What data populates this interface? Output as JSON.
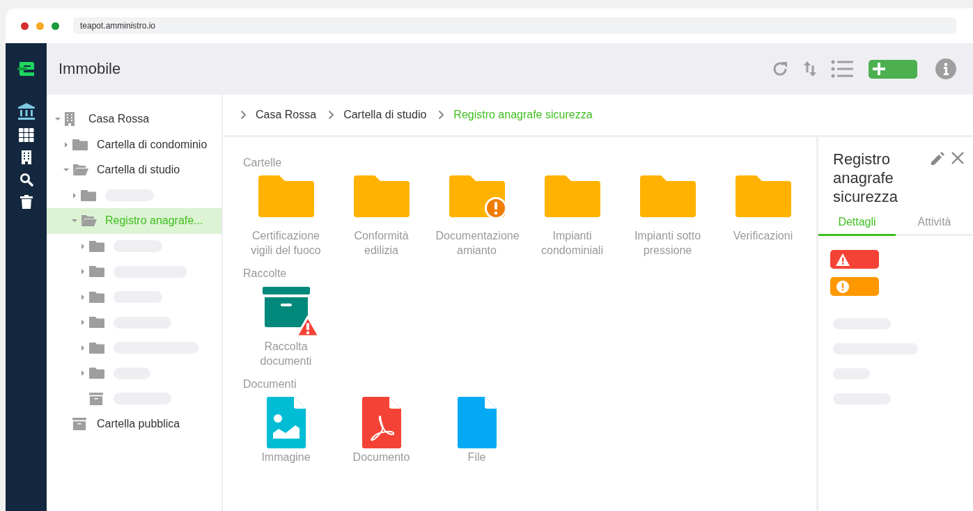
{
  "browser": {
    "address": "teapot.amministro.io"
  },
  "header": {
    "title": "Immobile"
  },
  "tree": [
    {
      "kind": "building",
      "label": "Casa Rossa",
      "expanded": true,
      "selected": false,
      "children": [
        {
          "kind": "folder",
          "label": "Cartella di condominio",
          "expanded": false,
          "selected": false
        },
        {
          "kind": "folder",
          "label": "Cartella di studio",
          "expanded": true,
          "selected": false,
          "children": [
            {
              "kind": "folder",
              "expanded": false,
              "selected": false
            },
            {
              "kind": "folder",
              "label": "Registro anagrafe...",
              "expanded": true,
              "selected": true,
              "children": [
                {
                  "kind": "folder",
                  "expanded": false,
                  "selected": false
                },
                {
                  "kind": "folder",
                  "expanded": false,
                  "selected": false
                },
                {
                  "kind": "folder",
                  "expanded": false,
                  "selected": false
                },
                {
                  "kind": "folder",
                  "expanded": false,
                  "selected": false
                },
                {
                  "kind": "folder",
                  "expanded": false,
                  "selected": false
                },
                {
                  "kind": "folder",
                  "expanded": false,
                  "selected": false
                },
                {
                  "kind": "archive",
                  "selected": false
                }
              ]
            }
          ]
        },
        {
          "kind": "archive",
          "label": "Cartella pubblica",
          "selected": false
        }
      ]
    }
  ],
  "breadcrumbs": [
    {
      "label": "Casa Rossa",
      "selected": false
    },
    {
      "label": "Cartella di studio",
      "selected": false
    },
    {
      "label": "Registro anagrafe sicurezza",
      "selected": true
    }
  ],
  "sections": [
    {
      "title": "Cartelle",
      "items": [
        {
          "kind": "folder",
          "label": "Certificazione vigili del fuoco"
        },
        {
          "kind": "folder",
          "label": "Conformità edilizia"
        },
        {
          "kind": "folder",
          "label": "Documentazione amianto",
          "alert": {
            "kind": "warning"
          }
        },
        {
          "kind": "folder",
          "label": "Impianti condominiali"
        },
        {
          "kind": "folder",
          "label": "Impianti sotto pressione"
        },
        {
          "kind": "folder",
          "label": "Verificazioni"
        }
      ]
    },
    {
      "title": "Raccolte",
      "items": [
        {
          "kind": "archive",
          "label": "Raccolta documenti",
          "alert": {
            "kind": "error"
          }
        }
      ]
    },
    {
      "title": "Documenti",
      "items": [
        {
          "kind": "image",
          "label": "Immagine"
        },
        {
          "kind": "pdf",
          "label": "Documento"
        },
        {
          "kind": "file",
          "label": "File"
        }
      ]
    }
  ],
  "details": {
    "title": "Registro anagrafe sicurezza",
    "tabs": [
      {
        "label": "Dettagli",
        "selected": true
      },
      {
        "label": "Attività",
        "selected": false
      }
    ],
    "statuses": [
      {
        "kind": "error"
      },
      {
        "kind": "warning"
      }
    ]
  }
}
